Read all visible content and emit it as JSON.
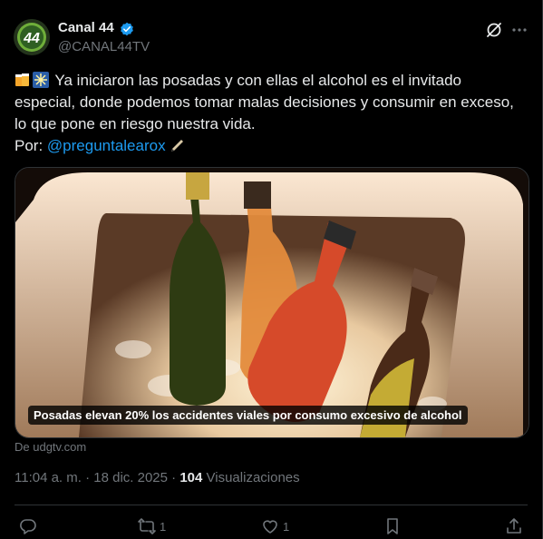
{
  "author": {
    "name": "Canal 44",
    "handle": "@CANAL44TV",
    "avatar_label": "44"
  },
  "tweet": {
    "text_part1": "Ya iniciaron las posadas y con ellas el alcohol es el invitado especial, donde podemos tomar malas decisiones y consumir en exceso, lo que pone en riesgo nuestra vida.",
    "by_label": "Por: ",
    "mention": "@preguntalearox"
  },
  "media": {
    "caption": "Posadas elevan 20% los accidentes viales por consumo excesivo de alcohol",
    "source": "De udgtv.com"
  },
  "meta": {
    "time": "11:04 a. m. · 18 dic. 2025 · ",
    "views_count": "104",
    "views_label": " Visualizaciones"
  },
  "actions": {
    "replies": "",
    "reposts": "1",
    "likes": "1"
  },
  "colors": {
    "accent": "#1d9bf0",
    "muted": "#71767b",
    "text": "#e7e9ea"
  },
  "icons": [
    "verified-badge-icon",
    "grok-icon",
    "more-icon",
    "beer-emoji-icon",
    "sparkle-emoji-icon",
    "pen-emoji-icon",
    "reply-icon",
    "repost-icon",
    "like-icon",
    "bookmark-icon",
    "share-icon"
  ]
}
